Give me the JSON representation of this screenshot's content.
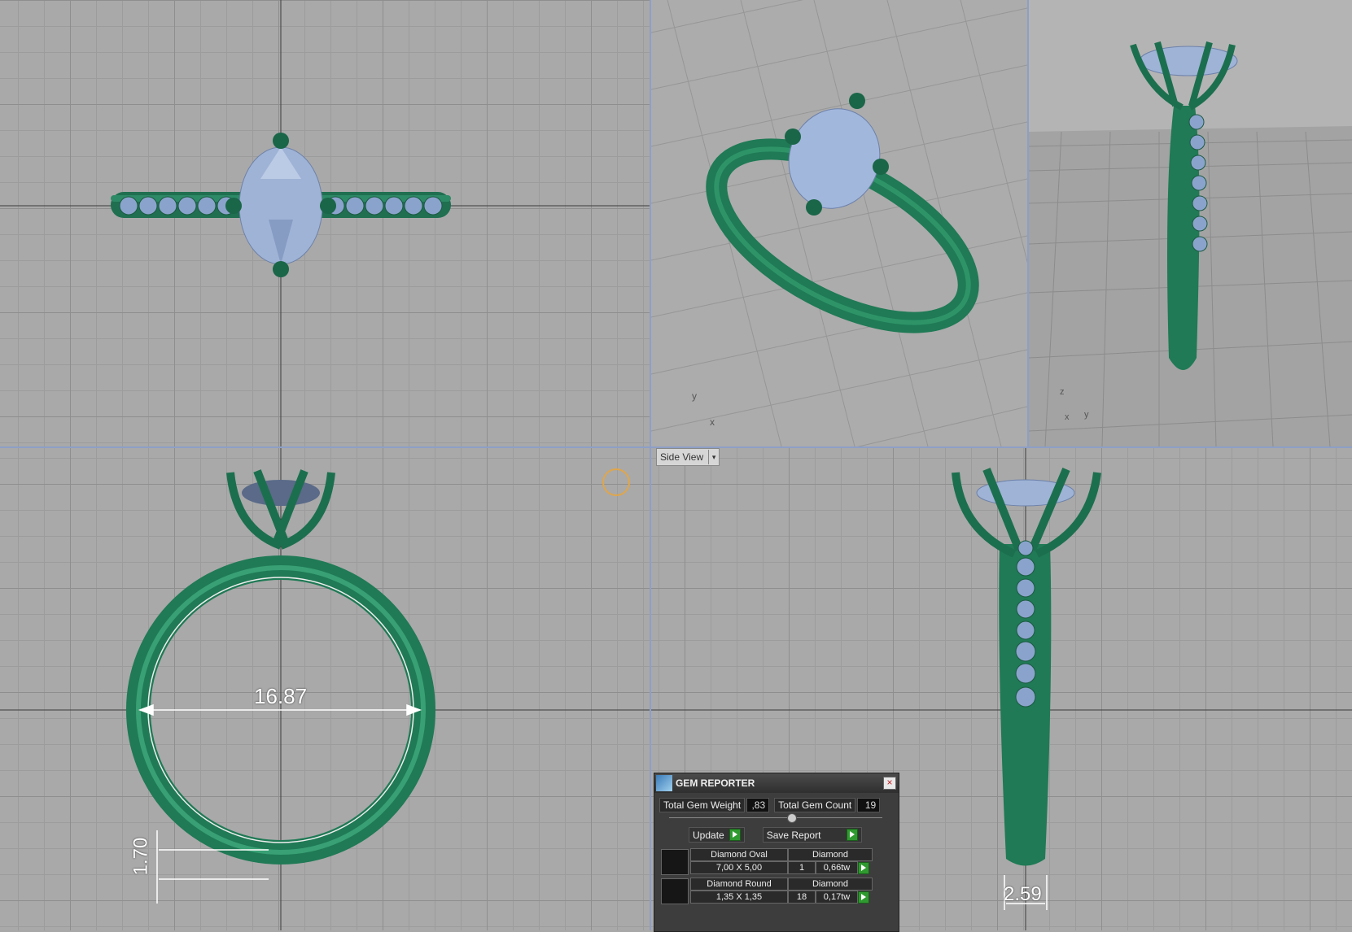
{
  "viewports": {
    "side_view_label": "Side View",
    "dropdown_icon": "chevron-down-icon"
  },
  "dimensions": {
    "inner_diameter": "16.87",
    "shank_thickness": "1.70",
    "shank_width": "2.59"
  },
  "axis_labels": {
    "persp": {
      "x": "x",
      "y": "y"
    },
    "right": {
      "z": "z",
      "x": "x",
      "y": "y"
    }
  },
  "gem_reporter": {
    "title": "GEM REPORTER",
    "total_weight_label": "Total Gem Weight",
    "total_weight_value": ",83",
    "total_count_label": "Total Gem Count",
    "total_count_value": "19",
    "update_label": "Update",
    "save_report_label": "Save Report",
    "gems": [
      {
        "name": "Diamond Oval",
        "material": "Diamond",
        "size": "7,00 X 5,00",
        "count": "1",
        "weight": "0,66tw"
      },
      {
        "name": "Diamond Round",
        "material": "Diamond",
        "size": "1,35 X 1,35",
        "count": "18",
        "weight": "0,17tw"
      }
    ]
  },
  "colors": {
    "metal": "#1f7a55",
    "gem": "#9fb6dc",
    "grid": "#a9a9a9",
    "divider": "#8d9fc6"
  }
}
